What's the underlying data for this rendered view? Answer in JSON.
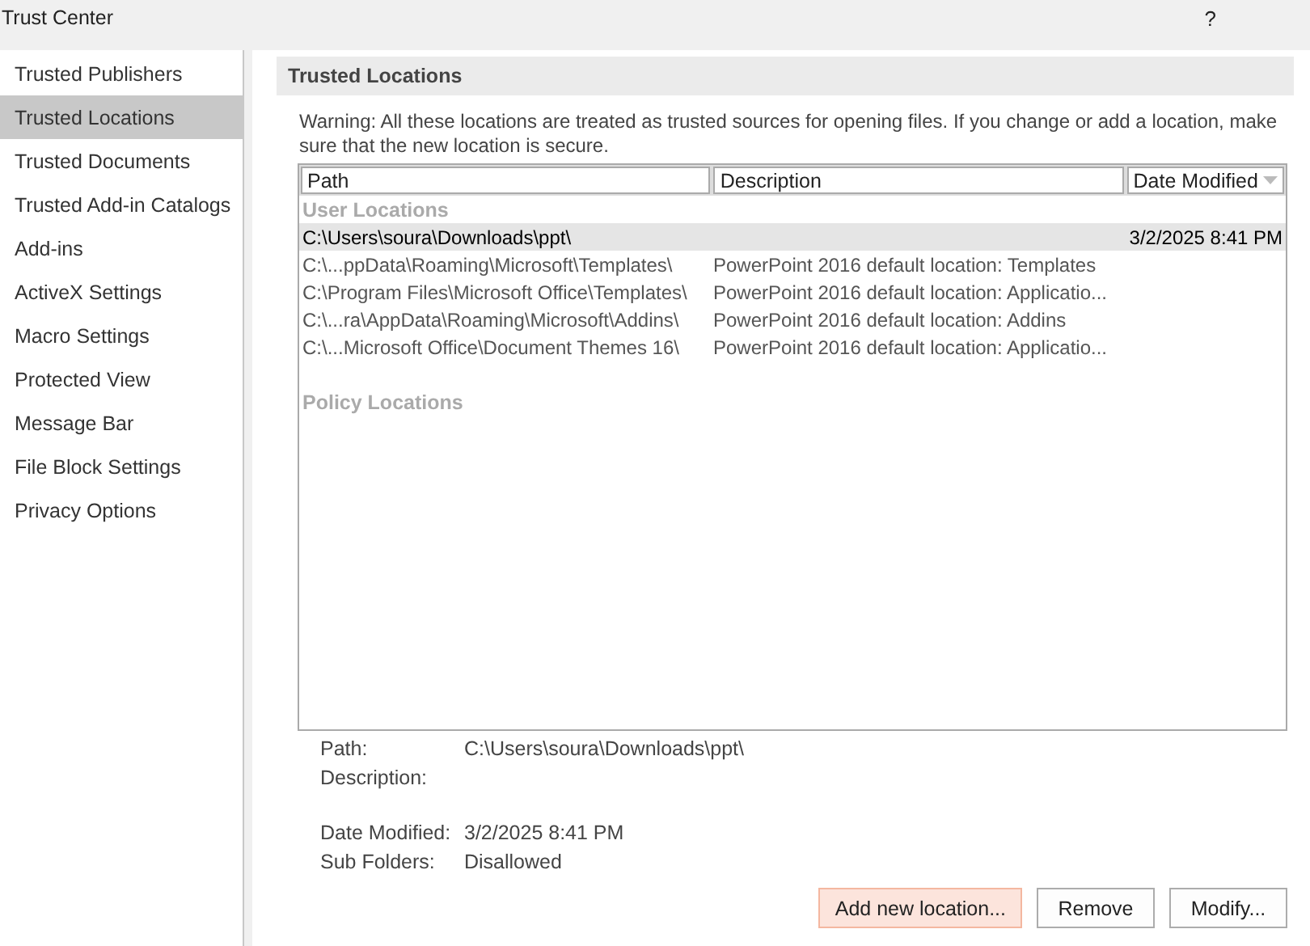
{
  "window": {
    "title": "Trust Center",
    "help": "?"
  },
  "sidebar": {
    "items": [
      {
        "label": "Trusted Publishers",
        "selected": false
      },
      {
        "label": "Trusted Locations",
        "selected": true
      },
      {
        "label": "Trusted Documents",
        "selected": false
      },
      {
        "label": "Trusted Add-in Catalogs",
        "selected": false
      },
      {
        "label": "Add-ins",
        "selected": false
      },
      {
        "label": "ActiveX Settings",
        "selected": false
      },
      {
        "label": "Macro Settings",
        "selected": false
      },
      {
        "label": "Protected View",
        "selected": false
      },
      {
        "label": "Message Bar",
        "selected": false
      },
      {
        "label": "File Block Settings",
        "selected": false
      },
      {
        "label": "Privacy Options",
        "selected": false
      }
    ]
  },
  "section": {
    "title": "Trusted Locations",
    "warning": "Warning: All these locations are treated as trusted sources for opening files.  If you change or add a location, make sure that the new location is secure."
  },
  "table": {
    "columns": [
      "Path",
      "Description",
      "Date Modified"
    ],
    "groups": [
      {
        "title": "User Locations",
        "rows": [
          {
            "path": "C:\\Users\\soura\\Downloads\\ppt\\",
            "date": "3/2/2025 8:41 PM",
            "selected": true
          },
          {
            "path": "C:\\...ppData\\Roaming\\Microsoft\\Templates\\",
            "description": "PowerPoint 2016 default location: Templates",
            "selected": false
          },
          {
            "path": "C:\\Program Files\\Microsoft Office\\Templates\\",
            "description": "PowerPoint 2016 default location: Applicatio...",
            "selected": false
          },
          {
            "path": "C:\\...ra\\AppData\\Roaming\\Microsoft\\Addins\\",
            "description": "PowerPoint 2016 default location: Addins",
            "selected": false
          },
          {
            "path": "C:\\...Microsoft Office\\Document Themes 16\\",
            "description": "PowerPoint 2016 default location: Applicatio...",
            "selected": false
          }
        ]
      },
      {
        "title": "Policy Locations"
      }
    ]
  },
  "details": [
    {
      "label": "Path:",
      "value": "C:\\Users\\soura\\Downloads\\ppt\\"
    },
    {
      "label": "Description:"
    },
    {
      "label": "Date Modified:",
      "value": "3/2/2025 8:41 PM"
    },
    {
      "label": "Sub Folders:",
      "value": "Disallowed"
    }
  ],
  "buttons": [
    {
      "label": "Add new location...",
      "selected": true
    },
    {
      "label": "Remove",
      "selected": false
    },
    {
      "label": "Modify...",
      "selected": false
    }
  ]
}
